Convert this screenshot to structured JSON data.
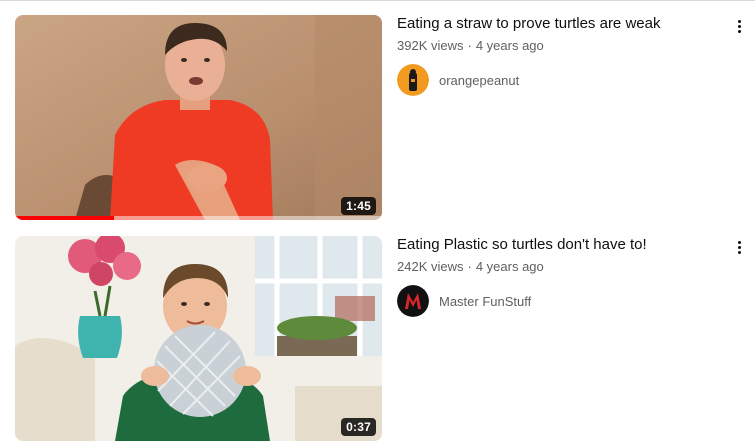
{
  "videos": [
    {
      "title": "Eating a straw to prove turtles are weak",
      "views": "392K views",
      "age": "4 years ago",
      "channel": "orangepeanut",
      "duration": "1:45",
      "watched_fraction": 0.27,
      "avatar_color": "#f29a1f"
    },
    {
      "title": "Eating Plastic so turtles don't have to!",
      "views": "242K views",
      "age": "4 years ago",
      "channel": "Master FunStuff",
      "duration": "0:37",
      "watched_fraction": 0,
      "avatar_color": "#111111"
    }
  ],
  "separator": "·",
  "icons": {
    "more": "more-vert-icon"
  },
  "colors": {
    "progress": "#ff0000",
    "secondary_text": "#606060"
  }
}
